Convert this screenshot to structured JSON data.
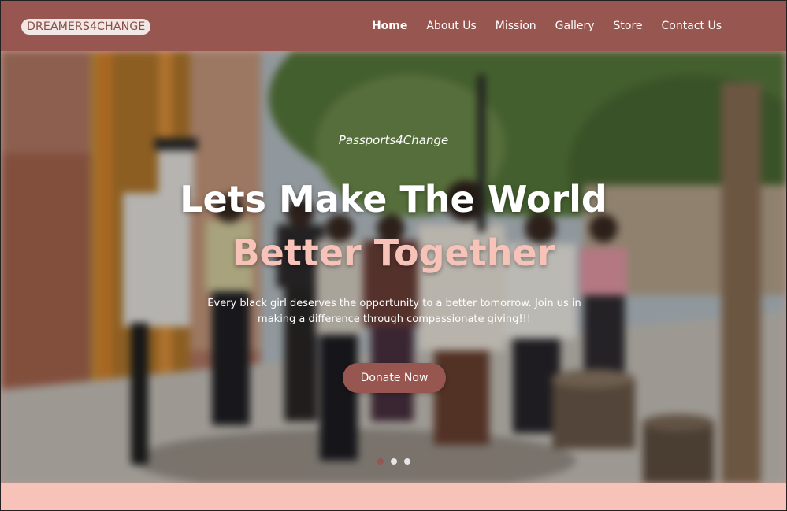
{
  "brand": {
    "logo_text": "DREAMERS4CHANGE"
  },
  "nav": {
    "items": [
      {
        "label": "Home",
        "active": true
      },
      {
        "label": "About Us"
      },
      {
        "label": "Mission"
      },
      {
        "label": "Gallery"
      },
      {
        "label": "Store"
      },
      {
        "label": "Contact Us"
      }
    ]
  },
  "hero": {
    "eyebrow": "Passports4Change",
    "headline": "Lets Make The World",
    "headline_accent": "Better Together",
    "subtext": "Every black girl deserves the opportunity to a better tomorrow. Join us in making a difference through compassionate giving!!!",
    "cta_label": "Donate Now",
    "slides": 3,
    "active_slide": 1
  },
  "colors": {
    "header_bg": "#985650",
    "accent_pink": "#f7c2b8",
    "button_bg": "#985650"
  }
}
